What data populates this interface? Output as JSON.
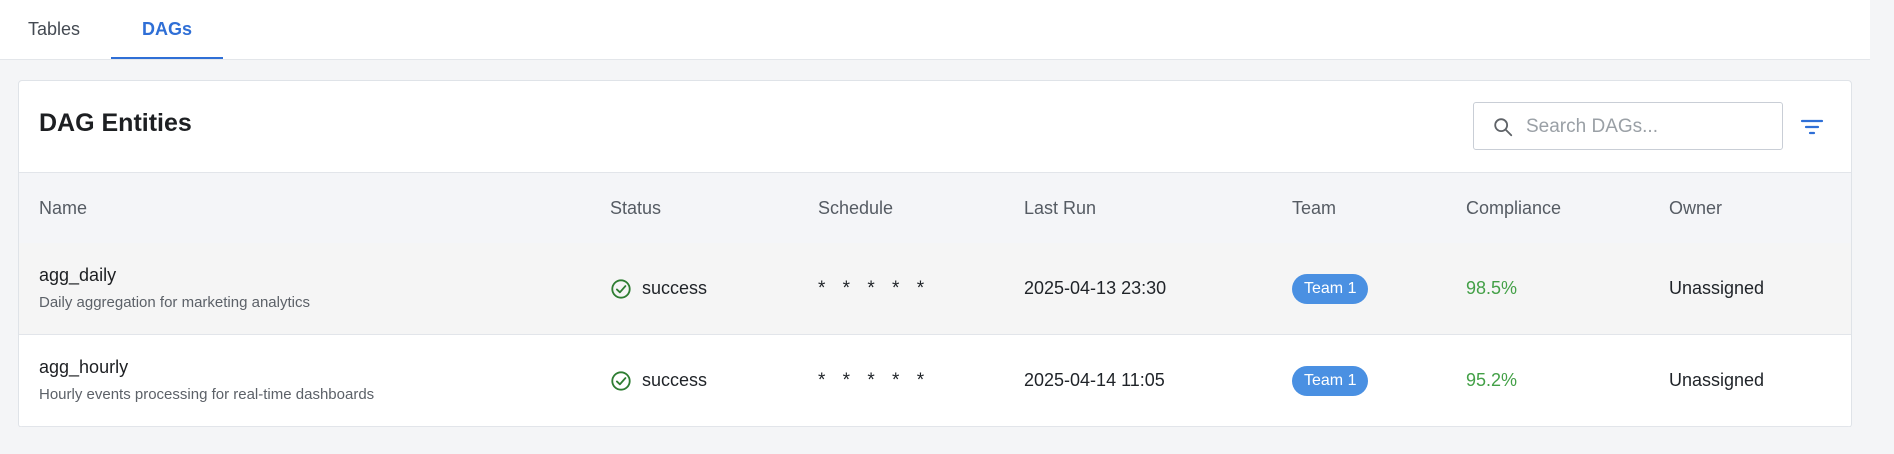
{
  "tabs": [
    {
      "label": "Tables",
      "active": false
    },
    {
      "label": "DAGs",
      "active": true
    }
  ],
  "card": {
    "title": "DAG Entities",
    "search_placeholder": "Search DAGs...",
    "search_value": ""
  },
  "icons": {
    "search": "search-icon",
    "filter": "filter-icon",
    "status_success": "check-circle-icon"
  },
  "colors": {
    "accent": "#2f6fd6",
    "badge": "#4a90e2",
    "success": "#43a047"
  },
  "table": {
    "columns": [
      "Name",
      "Status",
      "Schedule",
      "Last Run",
      "Team",
      "Compliance",
      "Owner"
    ],
    "rows": [
      {
        "name": "agg_daily",
        "description": "Daily aggregation for marketing analytics",
        "status": "success",
        "schedule": "* * * * *",
        "last_run": "2025-04-13 23:30",
        "team": "Team 1",
        "compliance": "98.5%",
        "owner": "Unassigned"
      },
      {
        "name": "agg_hourly",
        "description": "Hourly events processing for real-time dashboards",
        "status": "success",
        "schedule": "* * * * *",
        "last_run": "2025-04-14 11:05",
        "team": "Team 1",
        "compliance": "95.2%",
        "owner": "Unassigned"
      }
    ]
  }
}
